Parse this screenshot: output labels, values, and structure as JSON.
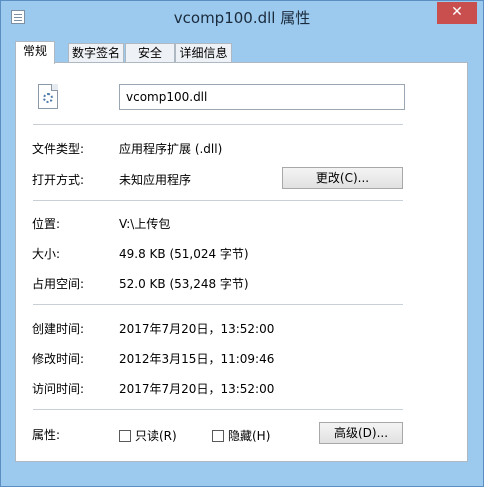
{
  "window": {
    "title": "vcomp100.dll 属性",
    "close_glyph": "✕"
  },
  "tabs": [
    {
      "label": "常规",
      "active": true
    },
    {
      "label": "数字签名"
    },
    {
      "label": "安全"
    },
    {
      "label": "详细信息"
    }
  ],
  "general": {
    "filename": "vcomp100.dll",
    "file_type_label": "文件类型:",
    "file_type_value": "应用程序扩展 (.dll)",
    "open_with_label": "打开方式:",
    "open_with_value": "未知应用程序",
    "change_button": "更改(C)...",
    "location_label": "位置:",
    "location_value": "V:\\上传包",
    "size_label": "大小:",
    "size_value": "49.8 KB (51,024 字节)",
    "size_on_disk_label": "占用空间:",
    "size_on_disk_value": "52.0 KB (53,248 字节)",
    "created_label": "创建时间:",
    "created_value": "2017年7月20日，13:52:00",
    "modified_label": "修改时间:",
    "modified_value": "2012年3月15日，11:09:46",
    "accessed_label": "访问时间:",
    "accessed_value": "2017年7月20日，13:52:00",
    "attributes_label": "属性:",
    "readonly_label": "只读(R)",
    "hidden_label": "隐藏(H)",
    "advanced_button": "高级(D)..."
  }
}
